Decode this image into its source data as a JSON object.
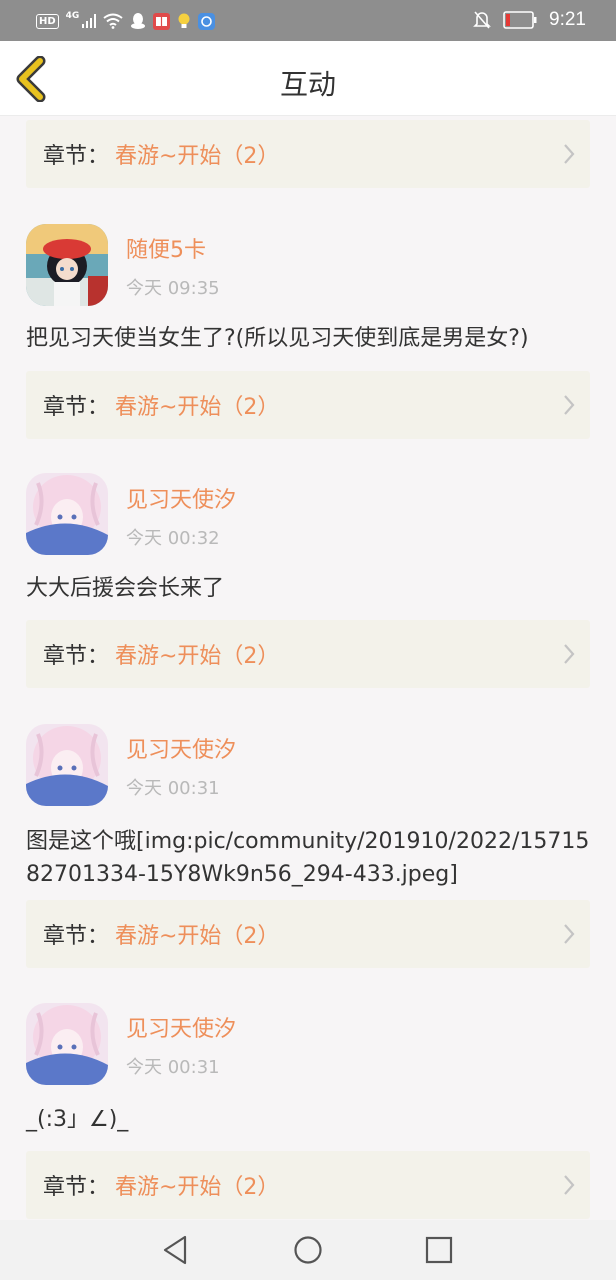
{
  "status_bar": {
    "hd": "HD",
    "network": "4G",
    "time": "9:21"
  },
  "header": {
    "title": "互动",
    "back_icon": "chevron-left-icon"
  },
  "chapter_prefix": "章节：",
  "items": [
    {
      "chapter": "春游~开始（2）"
    },
    {
      "user": "随便5卡",
      "time": "今天 09:35",
      "comment": "把见习天使当女生了?(所以见习天使到底是男是女?)",
      "chapter": "春游~开始（2）"
    },
    {
      "user": "见习天使汐",
      "time": "今天 00:32",
      "comment": "大大后援会会长来了",
      "chapter": "春游~开始（2）"
    },
    {
      "user": "见习天使汐",
      "time": "今天 00:31",
      "comment": "图是这个哦[img:pic/community/201910/2022/1571582701334-15Y8Wk9n56_294-433.jpeg]",
      "chapter": "春游~开始（2）"
    },
    {
      "user": "见习天使汐",
      "time": "今天 00:31",
      "comment": "_(:3」∠)_",
      "chapter": "春游~开始（2）"
    }
  ],
  "colors": {
    "accent": "#ee8f5a",
    "back_icon": "#e8c21f",
    "chapter_bg": "#f3f2ea"
  },
  "nav": [
    "back-triangle-icon",
    "home-circle-icon",
    "recents-square-icon"
  ]
}
